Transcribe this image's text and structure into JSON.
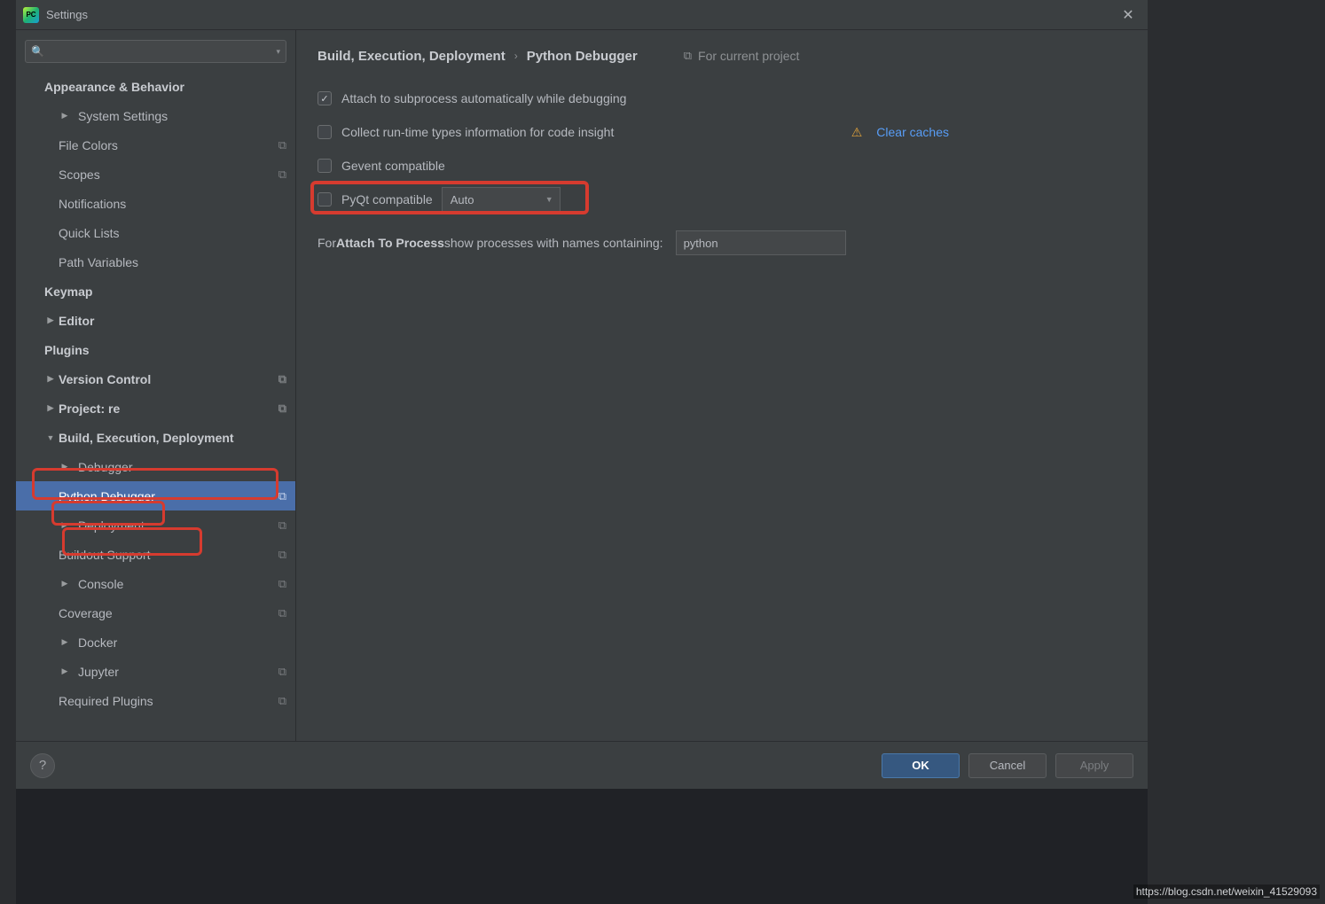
{
  "window": {
    "title": "Settings"
  },
  "breadcrumb": {
    "parent": "Build, Execution, Deployment",
    "current": "Python Debugger"
  },
  "projectBadge": "For current project",
  "sidebar": {
    "search_placeholder": "",
    "items": [
      {
        "label": "Appearance & Behavior",
        "bold": true
      },
      {
        "label": "System Settings",
        "level": 1,
        "arrow": "▶"
      },
      {
        "label": "File Colors",
        "level": 1,
        "copy": true
      },
      {
        "label": "Scopes",
        "level": 1,
        "copy": true
      },
      {
        "label": "Notifications",
        "level": 1
      },
      {
        "label": "Quick Lists",
        "level": 1
      },
      {
        "label": "Path Variables",
        "level": 1
      },
      {
        "label": "Keymap",
        "bold": true
      },
      {
        "label": "Editor",
        "bold": true,
        "arrow": "▶"
      },
      {
        "label": "Plugins",
        "bold": true
      },
      {
        "label": "Version Control",
        "bold": true,
        "arrow": "▶",
        "copy": true
      },
      {
        "label": "Project: re",
        "bold": true,
        "arrow": "▶",
        "copy": true
      },
      {
        "label": "Build, Execution, Deployment",
        "bold": true,
        "arrow": "▼",
        "red": true
      },
      {
        "label": "Debugger",
        "level": 1,
        "arrow": "▶",
        "red": true
      },
      {
        "label": "Python Debugger",
        "level": 1,
        "copy": true,
        "selected": true,
        "red": true
      },
      {
        "label": "Deployment",
        "level": 1,
        "arrow": "▶",
        "copy": true
      },
      {
        "label": "Buildout Support",
        "level": 1,
        "copy": true
      },
      {
        "label": "Console",
        "level": 1,
        "arrow": "▶",
        "copy": true
      },
      {
        "label": "Coverage",
        "level": 1,
        "copy": true
      },
      {
        "label": "Docker",
        "level": 1,
        "arrow": "▶"
      },
      {
        "label": "Jupyter",
        "level": 1,
        "arrow": "▶",
        "copy": true
      },
      {
        "label": "Required Plugins",
        "level": 1,
        "copy": true
      }
    ]
  },
  "form": {
    "attach_subprocess": "Attach to subprocess automatically while debugging",
    "collect_runtime": "Collect run-time types information for code insight",
    "gevent": "Gevent compatible",
    "pyqt": "PyQt compatible",
    "pyqt_mode": "Auto",
    "clear_caches": "Clear caches",
    "attach_label_pre": "For ",
    "attach_label_bold": "Attach To Process",
    "attach_label_post": " show processes with names containing:",
    "process_filter": "python"
  },
  "footer": {
    "ok": "OK",
    "cancel": "Cancel",
    "apply": "Apply"
  },
  "watermark": "https://blog.csdn.net/weixin_41529093"
}
